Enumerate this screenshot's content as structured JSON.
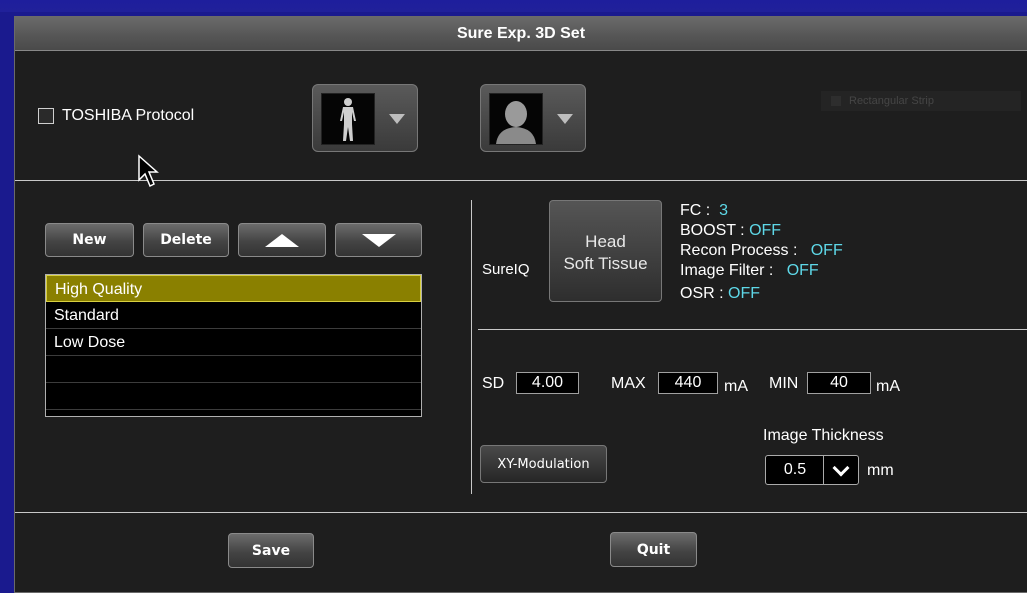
{
  "window": {
    "title": "Sure Exp. 3D Set"
  },
  "protocol": {
    "label": "TOSHIBA Protocol",
    "checked": false
  },
  "icons": {
    "body_selector": "full-body-figure-icon",
    "head_selector": "head-silhouette-icon"
  },
  "scan_type_hint": "Rectangular Strip",
  "toolbar": {
    "new_label": "New",
    "delete_label": "Delete",
    "up_icon": "up-triangle-icon",
    "down_icon": "down-triangle-icon"
  },
  "presets": {
    "items": [
      "High Quality",
      "Standard",
      "Low Dose",
      "",
      ""
    ],
    "selected_index": 0
  },
  "sureiq": {
    "label": "SureIQ",
    "button_line1": "Head",
    "button_line2": "Soft Tissue",
    "fc_label": "FC :",
    "fc_value": "3",
    "boost_label": "BOOST :",
    "boost_value": "OFF",
    "recon_label": "Recon Process :",
    "recon_value": "OFF",
    "filter_label": "Image Filter :",
    "filter_value": "OFF",
    "osr_label": "OSR :",
    "osr_value": "OFF"
  },
  "exposure": {
    "sd_label": "SD",
    "sd_value": "4.00",
    "max_label": "MAX",
    "max_value": "440",
    "max_unit": "mA",
    "min_label": "MIN",
    "min_value": "40",
    "min_unit": "mA"
  },
  "modulation": {
    "label": "XY-Modulation"
  },
  "thickness": {
    "label": "Image Thickness",
    "value": "0.5",
    "unit": "mm"
  },
  "footer": {
    "save_label": "Save",
    "quit_label": "Quit"
  },
  "colors": {
    "selection": "#8a8000",
    "value_accent": "#5ed8e8",
    "background": "#1a1a8e"
  }
}
